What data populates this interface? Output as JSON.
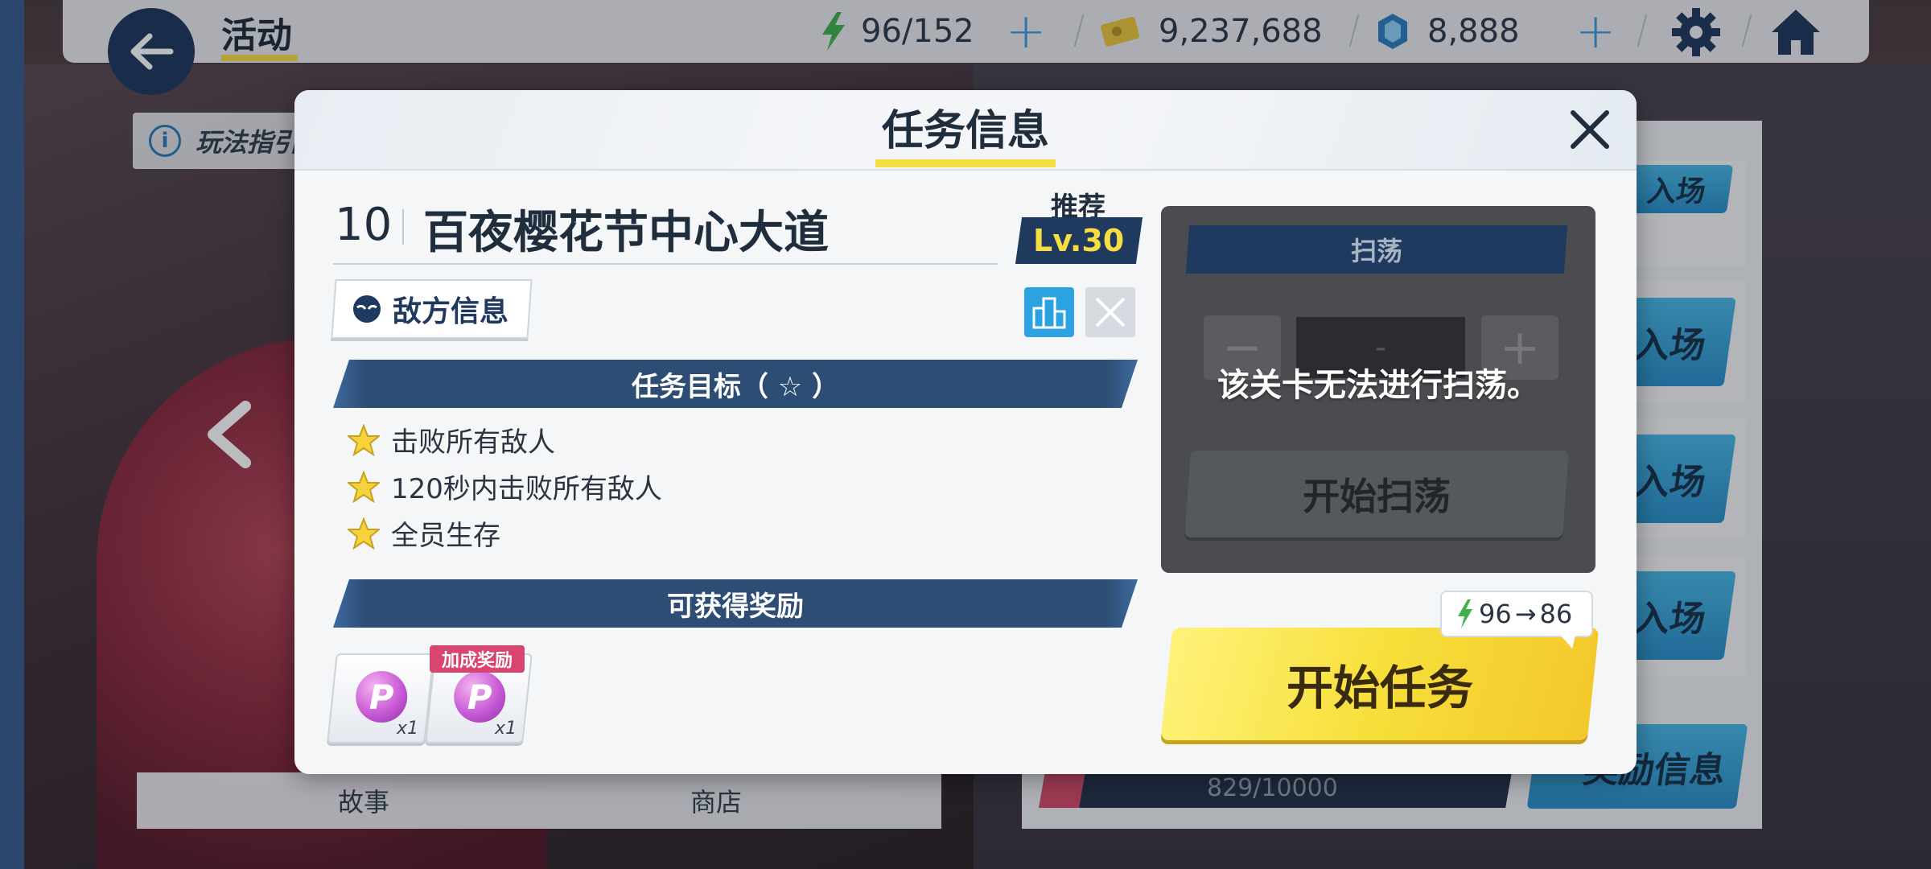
{
  "topbar": {
    "title": "活动",
    "ap": "96/152",
    "credits": "9,237,688",
    "gems": "8,888"
  },
  "background": {
    "guide_label": "玩法指引",
    "tab_story": "故事",
    "tab_shop": "商店",
    "card_enter_label": "入场",
    "progress_text": "829/10000",
    "info_button": "奖励信息"
  },
  "modal": {
    "title": "任务信息",
    "stage_number": "10",
    "stage_name": "百夜樱花节中心大道",
    "recommend_label": "推荐",
    "recommend_level": "Lv.30",
    "enemy_info_label": "敌方信息",
    "objectives_header": "任务目标（ ☆ ）",
    "objectives": [
      "击败所有敌人",
      "120秒内击败所有敌人",
      "全员生存"
    ],
    "rewards_header": "可获得奖励",
    "rewards": [
      {
        "icon": "P",
        "qty": "x1",
        "bonus": ""
      },
      {
        "icon": "P",
        "qty": "x1",
        "bonus": "加成奖励"
      }
    ],
    "sweep": {
      "title": "扫荡",
      "minus": "−",
      "count": "-",
      "plus": "+",
      "message": "该关卡无法进行扫荡。",
      "start_label": "开始扫荡"
    },
    "ap_change": {
      "from": "96",
      "to": "86"
    },
    "start_label": "开始任务"
  },
  "colors": {
    "accent_yellow": "#f6dd42",
    "navy": "#1f3a5e",
    "blue": "#2aa3e0",
    "pink_bonus": "#d8456e"
  }
}
